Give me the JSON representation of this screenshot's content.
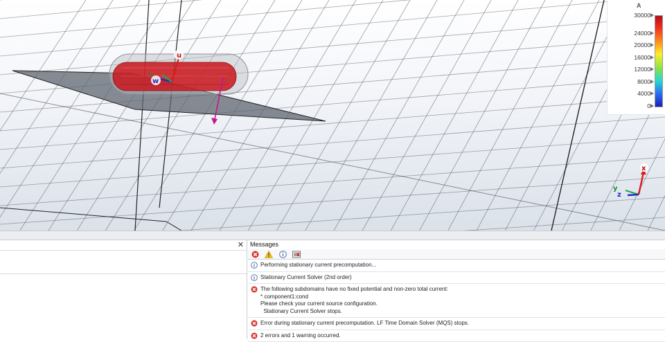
{
  "viewport": {
    "local_axes": {
      "u": "u",
      "v": "v",
      "w": "w"
    },
    "global_axes": {
      "x": "x",
      "y": "y",
      "z": "z"
    },
    "colors": {
      "wire": "#c9161c",
      "plane": "#5f6670",
      "grid": "#4a4f57",
      "pink_arrow": "#c0188f",
      "u_axis": "#d81c1c",
      "w_axis": "#1d2fc0",
      "v_axis": "#2aa64a"
    }
  },
  "legend": {
    "unit": "A",
    "ticks": [
      "30000",
      "24000",
      "20000",
      "16000",
      "12000",
      "8000",
      "4000",
      "0"
    ]
  },
  "messages": {
    "title": "Messages",
    "toolbar": [
      "error-filter-icon",
      "warning-filter-icon",
      "info-filter-icon",
      "clear-list-icon"
    ],
    "items": [
      {
        "type": "info",
        "lines": [
          "Performing stationary current precomputation..."
        ]
      },
      {
        "type": "info",
        "lines": [
          "Stationary Current Solver (2nd order)"
        ]
      },
      {
        "type": "error",
        "lines": [
          "The following subdomains have no fixed potential and non-zero total current:",
          "* component1:cond",
          "Please check your current source configuration.",
          "  Stationary Current Solver stops."
        ]
      },
      {
        "type": "error",
        "lines": [
          "Error during stationary current precomputation. LF Time Domain Solver (MQS) stops."
        ]
      },
      {
        "type": "error",
        "lines": [
          "2 errors and 1 warning occurred."
        ]
      }
    ]
  },
  "left_panel": {
    "close_label": "✕"
  }
}
